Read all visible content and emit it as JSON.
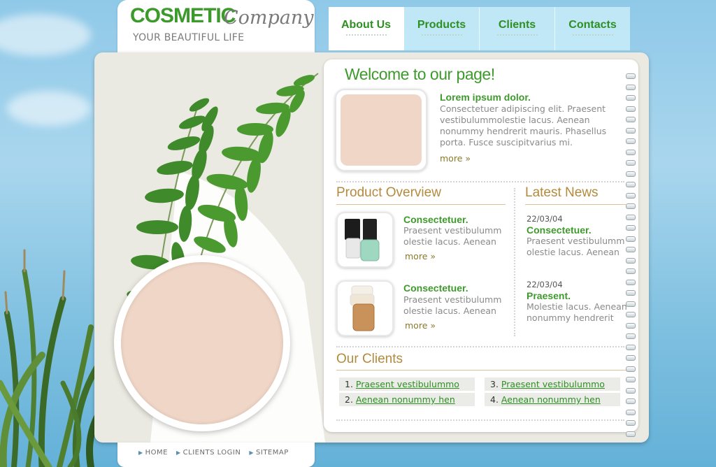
{
  "brand": {
    "name": "COSMETIC",
    "script": "Company",
    "tagline": "YOUR BEAUTIFUL LIFE"
  },
  "nav": [
    {
      "label": "About Us",
      "active": true
    },
    {
      "label": "Products",
      "active": false
    },
    {
      "label": "Clients",
      "active": false
    },
    {
      "label": "Contacts",
      "active": false
    }
  ],
  "welcome": {
    "heading": "Welcome to our page!",
    "title": "Lorem ipsum dolor.",
    "text": "Consectetuer adipiscing elit. Praesent vestibulummolestie lacus. Aenean nonummy hendrerit mauris. Phasellus porta. Fusce suscipitvarius mi.",
    "more": "more »"
  },
  "product_overview": {
    "heading": "Product Overview",
    "items": [
      {
        "title": "Consectetuer.",
        "text": "Praesent vestibulumm olestie lacus. Aenean",
        "more": "more »"
      },
      {
        "title": "Consectetuer.",
        "text": "Praesent vestibulumm olestie lacus. Aenean",
        "more": "more »"
      }
    ]
  },
  "latest_news": {
    "heading": "Latest News",
    "items": [
      {
        "date": "22/03/04",
        "title": "Consectetuer.",
        "text": "Praesent vestibulumm olestie lacus. Aenean"
      },
      {
        "date": "22/03/04",
        "title": "Praesent.",
        "text": "Molestie lacus. Aenean nonummy hendrerit"
      }
    ]
  },
  "our_clients": {
    "heading": "Our Clients",
    "items": [
      {
        "num": "1.",
        "label": "Praesent vestibulummo"
      },
      {
        "num": "2.",
        "label": "Aenean nonummy hen"
      },
      {
        "num": "3.",
        "label": "Praesent vestibulummo"
      },
      {
        "num": "4.",
        "label": "Aenean nonummy hen"
      }
    ]
  },
  "footer": {
    "links": [
      "HOME",
      "CLIENTS LOGIN",
      "SITEMAP"
    ]
  },
  "colors": {
    "green": "#3e9a2c",
    "gold": "#b48a3c",
    "placeholder": "#f0d6c6"
  }
}
